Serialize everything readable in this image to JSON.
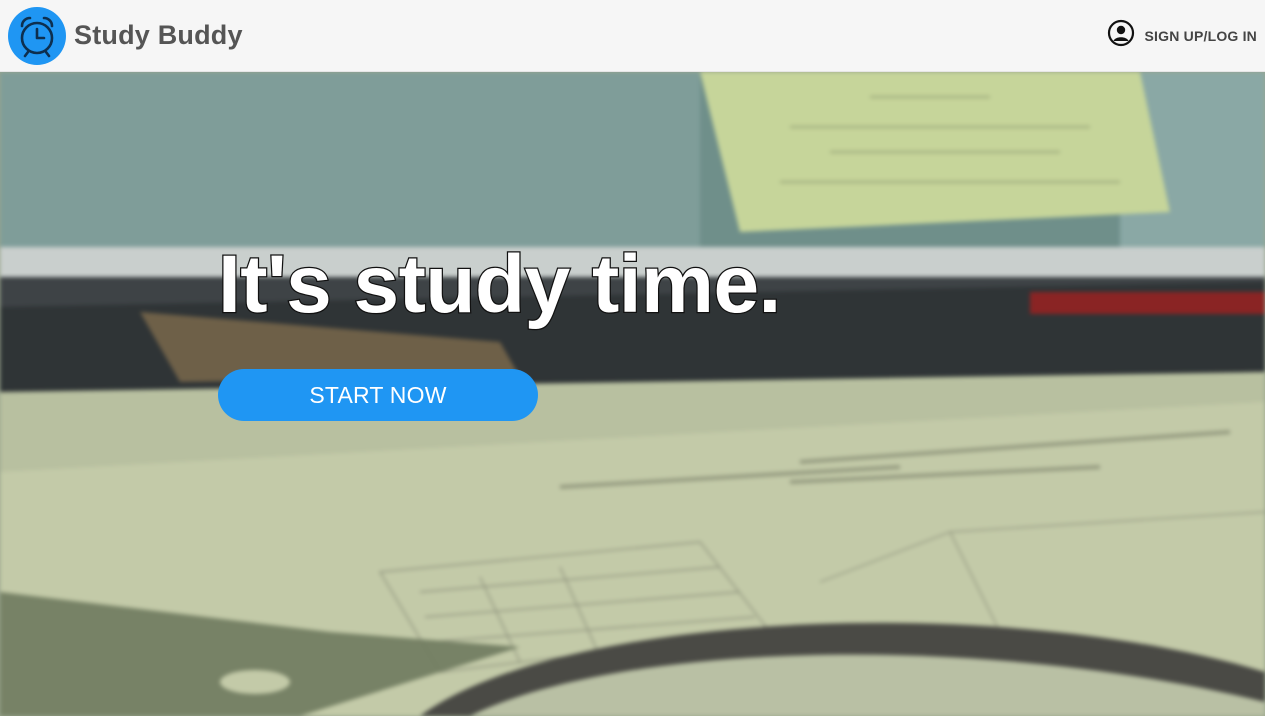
{
  "nav": {
    "brand": "Study Buddy",
    "auth_label": "SIGN UP/LOG IN",
    "logo_icon": "alarm-clock-icon",
    "user_icon": "user-icon"
  },
  "hero": {
    "headline": "It's study time.",
    "cta_label": "START NOW"
  },
  "colors": {
    "accent": "#1f96f3",
    "navbar_bg": "#f6f6f6",
    "brand_text": "#555555"
  }
}
